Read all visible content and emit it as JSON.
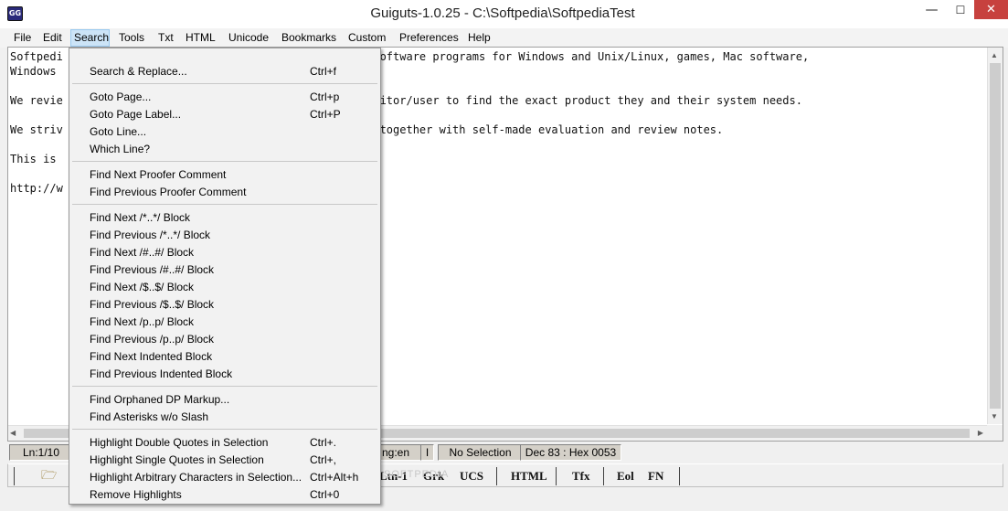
{
  "window": {
    "title": "Guiguts-1.0.25 - C:\\Softpedia\\SoftpediaTest",
    "icon_label": "GG",
    "minimize_glyph": "—",
    "maximize_glyph": "☐",
    "close_glyph": "✕"
  },
  "menubar": [
    "File",
    "Edit",
    "Search",
    "Tools",
    "Txt",
    "HTML",
    "Unicode",
    "Bookmarks",
    "Custom",
    "Preferences",
    "Help"
  ],
  "editor": {
    "lines": [
      "Softpedi                                   free-to-try software programs for Windows and Unix/Linux, games, Mac software,",
      "Windows                                    icles.",
      "We revie                                   allow the visitor/user to find the exact product they and their system needs.",
      "We striv                                   visitor/user together with self-made evaluation and review notes.",
      "This is ",
      "http://w"
    ]
  },
  "statusbar": {
    "line_col": "Ln:1/10",
    "lang": "ng:en",
    "insert": "I",
    "selection": "No Selection",
    "char_code": "Dec 83 : Hex 0053"
  },
  "toolbar": {
    "open_icon": "open-folder-icon",
    "buttons": [
      "Ltn-1",
      "Grk",
      "UCS",
      "HTML",
      "Tfx",
      "Eol",
      "FN"
    ]
  },
  "search_menu": {
    "items": [
      {
        "label": "Search & Replace...",
        "shortcut": "Ctrl+f"
      },
      {
        "label": "Goto Page...",
        "shortcut": "Ctrl+p"
      },
      {
        "label": "Goto Page Label...",
        "shortcut": "Ctrl+P"
      },
      {
        "label": "Goto Line...",
        "shortcut": ""
      },
      {
        "label": "Which Line?",
        "shortcut": ""
      },
      {
        "label": "Find Next Proofer Comment",
        "shortcut": ""
      },
      {
        "label": "Find Previous Proofer Comment",
        "shortcut": ""
      },
      {
        "label": "Find Next /*..*/ Block",
        "shortcut": ""
      },
      {
        "label": "Find Previous /*..*/ Block",
        "shortcut": ""
      },
      {
        "label": "Find Next /#..#/ Block",
        "shortcut": ""
      },
      {
        "label": "Find Previous /#..#/ Block",
        "shortcut": ""
      },
      {
        "label": "Find Next /$..$/ Block",
        "shortcut": ""
      },
      {
        "label": "Find Previous /$..$/ Block",
        "shortcut": ""
      },
      {
        "label": "Find Next /p..p/ Block",
        "shortcut": ""
      },
      {
        "label": "Find Previous /p..p/ Block",
        "shortcut": ""
      },
      {
        "label": "Find Next Indented Block",
        "shortcut": ""
      },
      {
        "label": "Find Previous Indented Block",
        "shortcut": ""
      },
      {
        "label": "Find Orphaned DP Markup...",
        "shortcut": ""
      },
      {
        "label": "Find Asterisks w/o Slash",
        "shortcut": ""
      },
      {
        "label": "Highlight Double Quotes in Selection",
        "shortcut": "Ctrl+."
      },
      {
        "label": "Highlight Single Quotes in Selection",
        "shortcut": "Ctrl+,"
      },
      {
        "label": "Highlight Arbitrary Characters in Selection...",
        "shortcut": "Ctrl+Alt+h"
      },
      {
        "label": "Remove Highlights",
        "shortcut": "Ctrl+0"
      }
    ]
  },
  "watermark": "SOFTPEDIA"
}
